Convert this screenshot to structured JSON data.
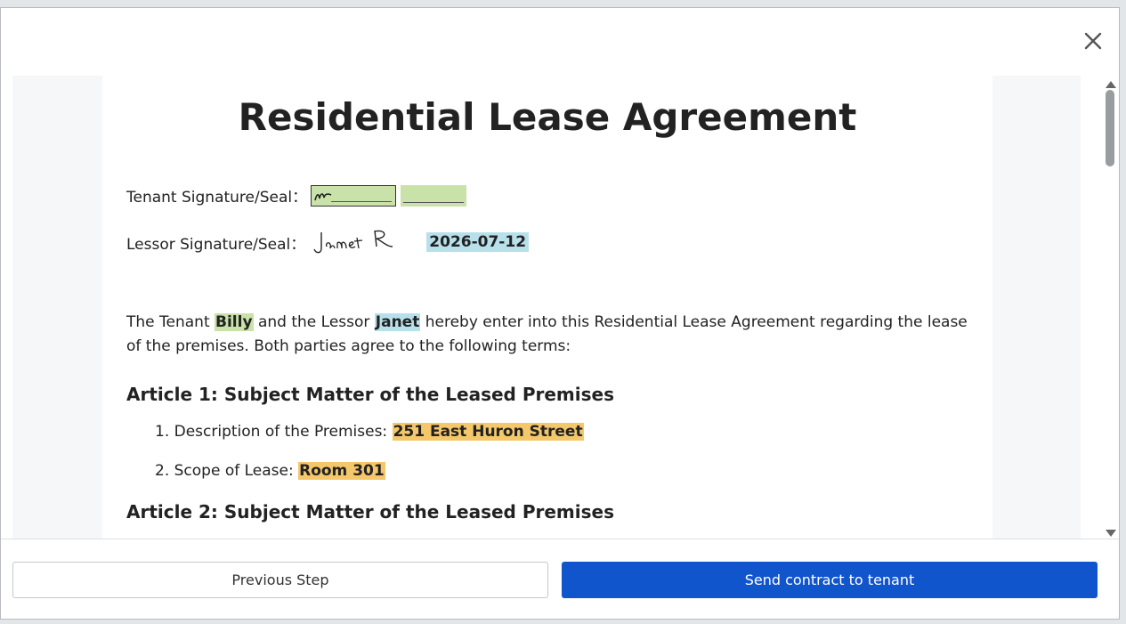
{
  "document": {
    "title": "Residential Lease Agreement",
    "tenant_sig_label": "Tenant Signature/Seal：",
    "lessor_sig_label": "Lessor Signature/Seal：",
    "lessor_sig_date": "2026-07-12",
    "intro_prefix": "The Tenant ",
    "tenant_name": "Billy",
    "intro_mid": " and the Lessor ",
    "lessor_name": "Janet",
    "intro_suffix": " hereby enter into this Residential Lease Agreement regarding the lease of the premises. Both parties agree to the following terms:",
    "article1_title": "Article 1: Subject Matter of the Leased Premises",
    "item1_label": "1. Description of the Premises: ",
    "item1_value": "251 East Huron Street",
    "item2_label": "2. Scope of Lease: ",
    "item2_value": "Room 301",
    "article2_title": "Article 2: Subject Matter of the Leased Premises"
  },
  "footer": {
    "prev_label": "Previous Step",
    "send_label": "Send contract to tenant"
  },
  "colors": {
    "primary": "#1155cc",
    "tenant_highlight": "#c9e2a9",
    "lessor_highlight": "#b8e0ea",
    "field_highlight": "#f4c76a"
  }
}
